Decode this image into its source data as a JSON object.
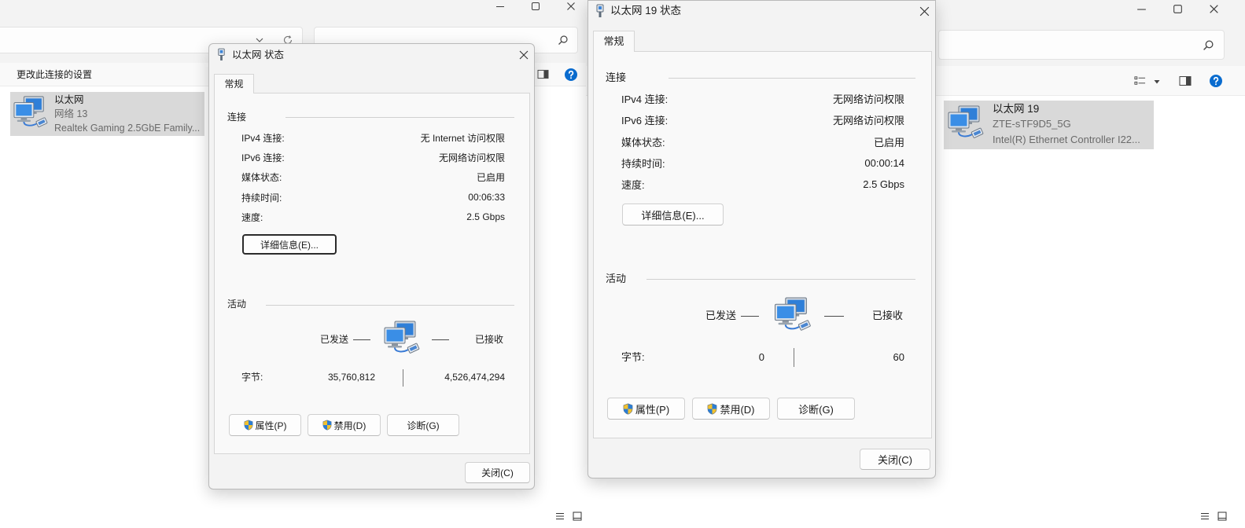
{
  "colors": {
    "selection": "#d9d9d9",
    "dialog_bg": "#f3f3f3",
    "panel_bg": "#f9f9f9",
    "screen_blue": "#2f7fd8",
    "help_icon": "#0a6ccf"
  },
  "left": {
    "explorer": {
      "icons": [
        "minimize-icon",
        "maximize-icon",
        "close-icon",
        "chevron-down-icon",
        "refresh-icon",
        "search-icon",
        "preview-pane-icon",
        "help-icon",
        "network-adapter-icon",
        "details-view-icon",
        "large-icons-view-icon"
      ],
      "toolbar": {
        "change_settings": "更改此连接的设置"
      },
      "item": {
        "name": "以太网",
        "network": "网络 13",
        "adapter": "Realtek Gaming 2.5GbE Family..."
      }
    },
    "dialog": {
      "title": "以太网 状态",
      "tab": "常规",
      "connection_section": "连接",
      "rows": [
        {
          "label": "IPv4 连接:",
          "value": "无 Internet 访问权限"
        },
        {
          "label": "IPv6 连接:",
          "value": "无网络访问权限"
        },
        {
          "label": "媒体状态:",
          "value": "已启用"
        },
        {
          "label": "持续时间:",
          "value": "00:06:33"
        },
        {
          "label": "速度:",
          "value": "2.5 Gbps"
        }
      ],
      "details_button": "详细信息(E)...",
      "activity_section": "活动",
      "sent_label": "已发送",
      "received_label": "已接收",
      "bytes_label": "字节:",
      "bytes_sent": "35,760,812",
      "bytes_received": "4,526,474,294",
      "properties_button": "属性(P)",
      "disable_button": "禁用(D)",
      "diagnose_button": "诊断(G)",
      "close_button": "关闭(C)"
    }
  },
  "right": {
    "explorer": {
      "icons": [
        "minimize-icon",
        "maximize-icon",
        "close-icon",
        "search-icon",
        "change-view-icon",
        "dropdown-arrow-icon",
        "preview-pane-icon",
        "help-icon",
        "network-adapter-icon",
        "details-view-icon",
        "large-icons-view-icon"
      ],
      "item": {
        "name": "以太网 19",
        "ssid": "ZTE-sTF9D5_5G",
        "adapter": "Intel(R) Ethernet Controller I22..."
      }
    },
    "dialog": {
      "title": "以太网 19 状态",
      "tab": "常规",
      "connection_section": "连接",
      "rows": [
        {
          "label": "IPv4 连接:",
          "value": "无网络访问权限"
        },
        {
          "label": "IPv6 连接:",
          "value": "无网络访问权限"
        },
        {
          "label": "媒体状态:",
          "value": "已启用"
        },
        {
          "label": "持续时间:",
          "value": "00:00:14"
        },
        {
          "label": "速度:",
          "value": "2.5 Gbps"
        }
      ],
      "details_button": "详细信息(E)...",
      "activity_section": "活动",
      "sent_label": "已发送",
      "received_label": "已接收",
      "bytes_label": "字节:",
      "bytes_sent": "0",
      "bytes_received": "60",
      "properties_button": "属性(P)",
      "disable_button": "禁用(D)",
      "diagnose_button": "诊断(G)",
      "close_button": "关闭(C)"
    }
  }
}
